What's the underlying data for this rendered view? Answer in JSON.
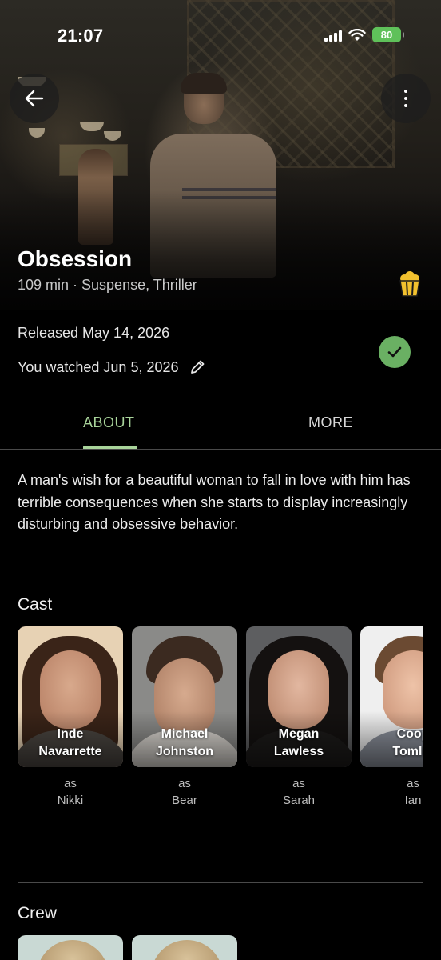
{
  "status_bar": {
    "time": "21:07",
    "battery": "80"
  },
  "movie": {
    "title": "Obsession",
    "meta": "109 min · Suspense, Thriller",
    "released": "Released May 14, 2026",
    "watched": "You watched Jun 5, 2026"
  },
  "tabs": [
    {
      "label": "ABOUT",
      "active": true
    },
    {
      "label": "MORE",
      "active": false
    }
  ],
  "synopsis": "A man's wish for a beautiful woman to fall in love with him has terrible consequences when she starts to display increasingly disturbing and obsessive behavior.",
  "cast": {
    "title": "Cast",
    "members": [
      {
        "name_line1": "Inde",
        "name_line2": "Navarrette",
        "as": "as",
        "role": "Nikki"
      },
      {
        "name_line1": "Michael",
        "name_line2": "Johnston",
        "as": "as",
        "role": "Bear"
      },
      {
        "name_line1": "Megan",
        "name_line2": "Lawless",
        "as": "as",
        "role": "Sarah"
      },
      {
        "name_line1": "Coop",
        "name_line2": "Tomlin",
        "as": "as",
        "role": "Ian"
      }
    ]
  },
  "crew": {
    "title": "Crew"
  },
  "icons": {
    "back": "arrow-left-icon",
    "more": "more-vertical-icon",
    "popcorn": "popcorn-icon",
    "watched": "check-icon",
    "edit": "pencil-icon"
  },
  "colors": {
    "accent": "#a9d49b",
    "watched_badge": "#6ab063",
    "popcorn": "#f2c12e",
    "battery": "#5fc15a"
  }
}
